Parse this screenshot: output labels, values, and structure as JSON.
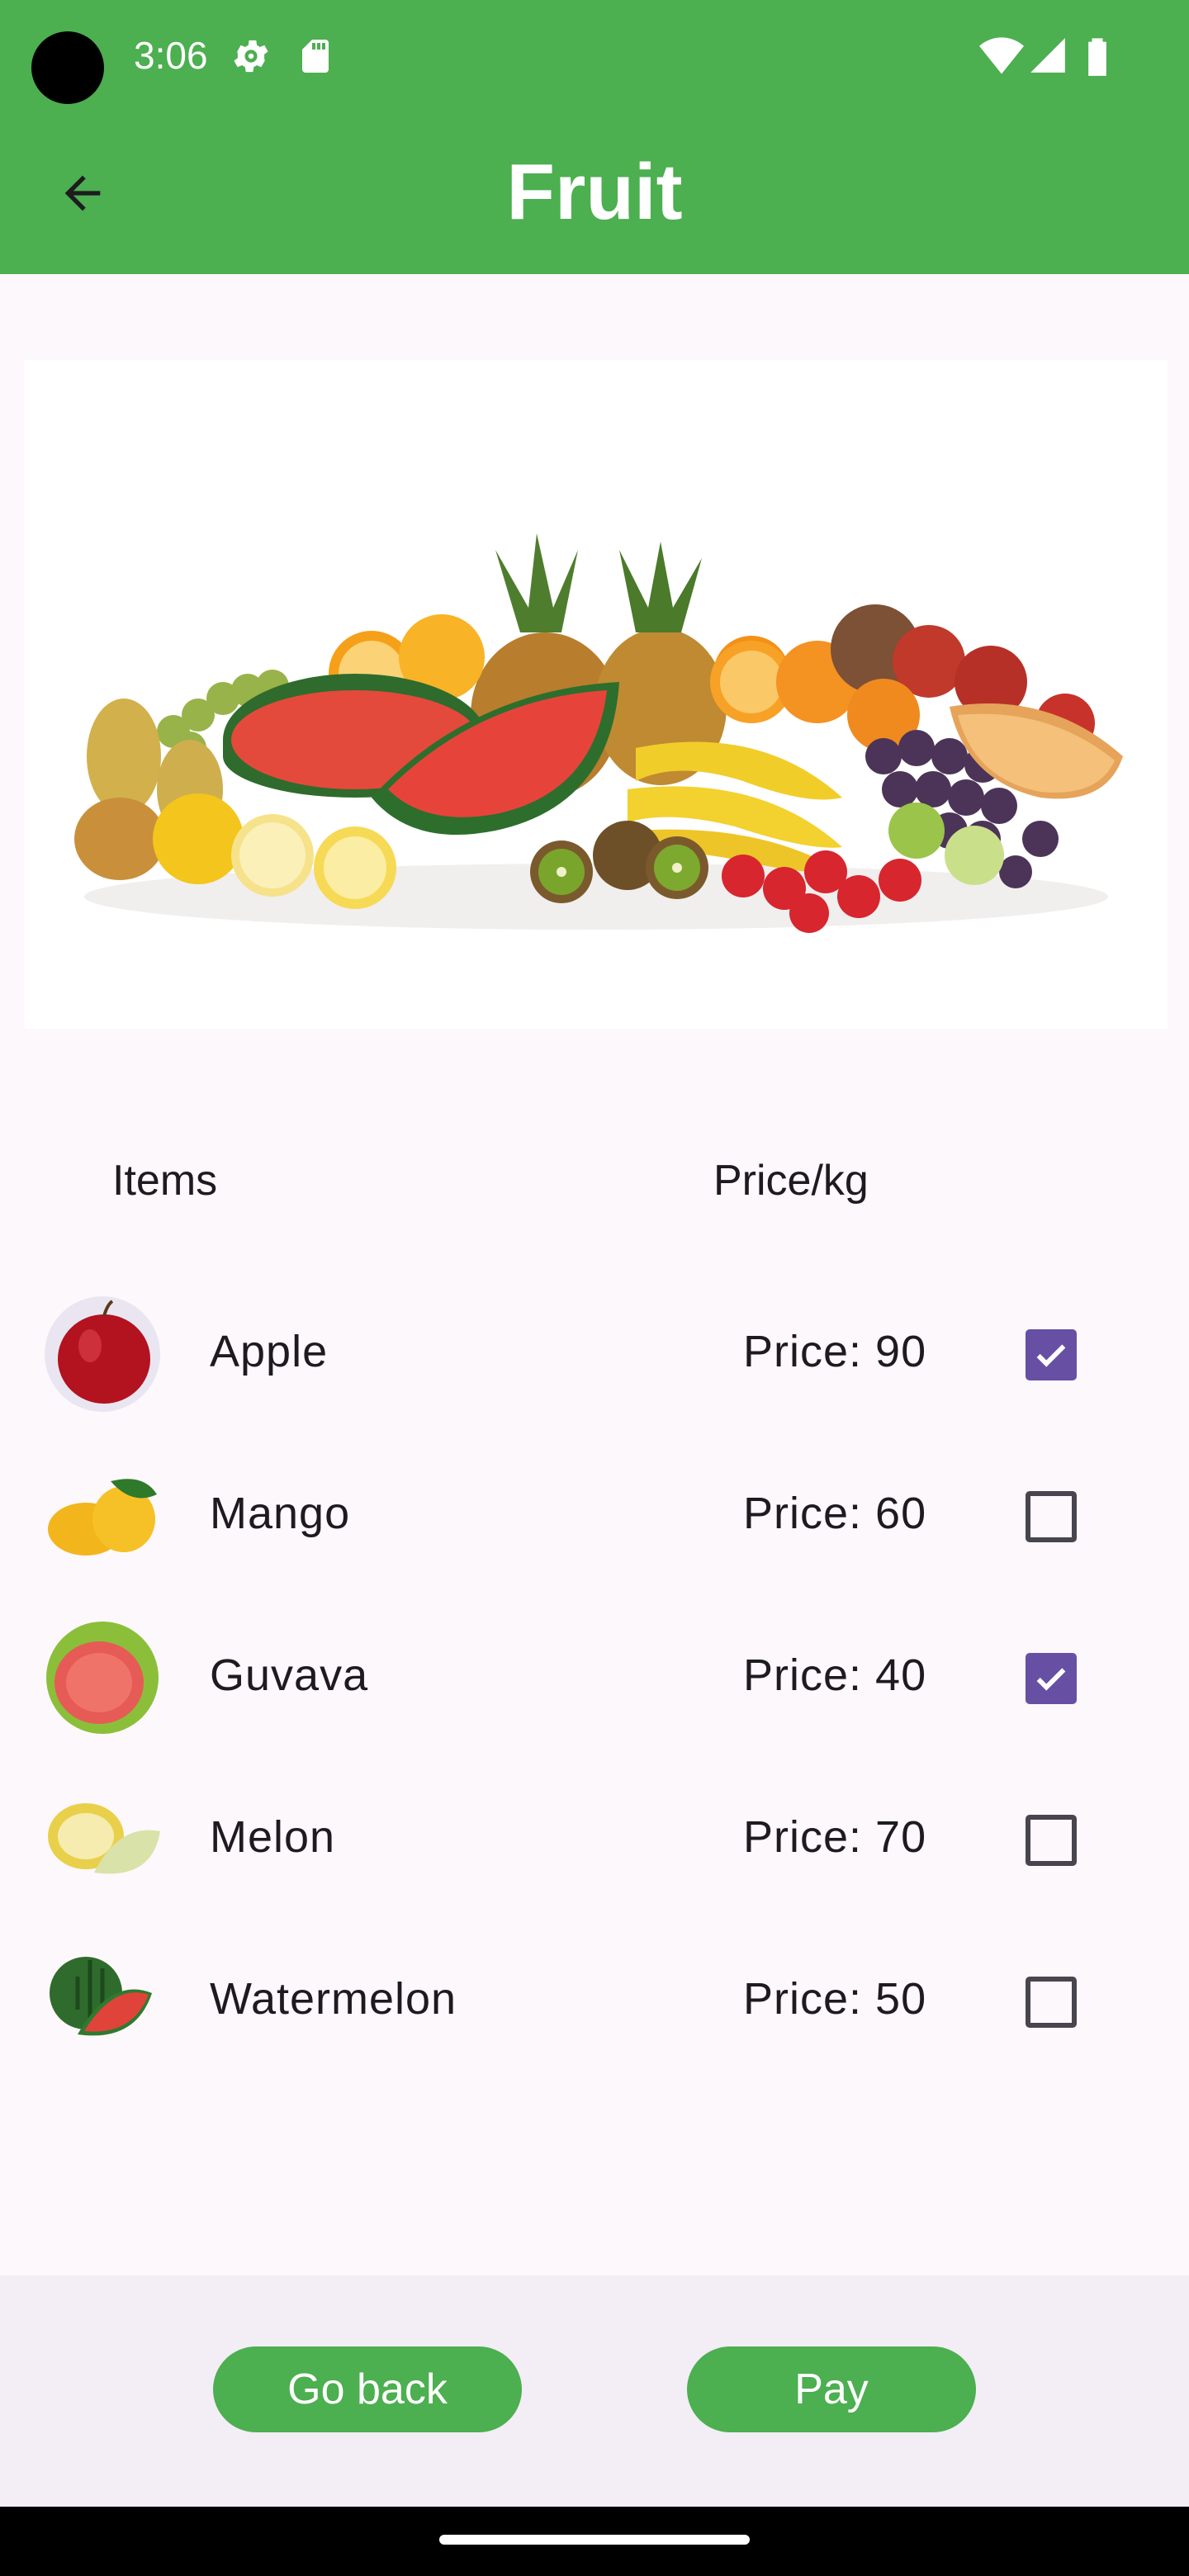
{
  "status_bar": {
    "time": "3:06",
    "icons": [
      "settings-gear-icon",
      "sd-card-icon",
      "wifi-icon",
      "cellular-signal-icon",
      "battery-icon"
    ]
  },
  "app_bar": {
    "title": "Fruit",
    "back_icon": "arrow-back-icon"
  },
  "hero_image": {
    "description_icon": "assorted-fruit-photo"
  },
  "table": {
    "col_items": "Items",
    "col_price": "Price/kg",
    "rows": [
      {
        "name": "Apple",
        "price": "Price: 90",
        "checked": true
      },
      {
        "name": "Mango",
        "price": "Price: 60",
        "checked": false
      },
      {
        "name": "Guvava",
        "price": "Price: 40",
        "checked": true
      },
      {
        "name": "Melon",
        "price": "Price: 70",
        "checked": false
      },
      {
        "name": "Watermelon",
        "price": "Price: 50",
        "checked": false
      }
    ]
  },
  "actions": {
    "go_back": "Go back",
    "pay": "Pay"
  },
  "colors": {
    "primary_green": "#4caf50",
    "checkbox_purple": "#6750a4",
    "background": "#fdf8fb"
  }
}
